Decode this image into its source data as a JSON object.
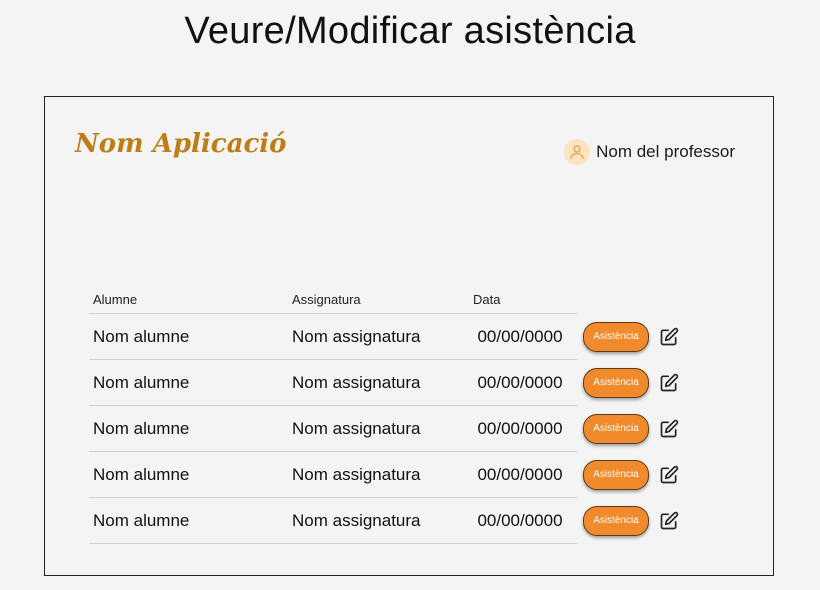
{
  "page_title": "Veure/Modificar asistència",
  "header": {
    "app_name": "Nom Aplicació",
    "user_name": "Nom del professor",
    "avatar_icon": "user-icon"
  },
  "table": {
    "columns": [
      "Alumne",
      "Assignatura",
      "Data"
    ],
    "rows": [
      {
        "alumne": "Nom alumne",
        "assignatura": "Nom assignatura",
        "data": "00/00/0000",
        "button": "Asistència"
      },
      {
        "alumne": "Nom alumne",
        "assignatura": "Nom assignatura",
        "data": "00/00/0000",
        "button": "Asistència"
      },
      {
        "alumne": "Nom alumne",
        "assignatura": "Nom assignatura",
        "data": "00/00/0000",
        "button": "Asistència"
      },
      {
        "alumne": "Nom alumne",
        "assignatura": "Nom assignatura",
        "data": "00/00/0000",
        "button": "Asistència"
      },
      {
        "alumne": "Nom alumne",
        "assignatura": "Nom assignatura",
        "data": "00/00/0000",
        "button": "Asistència"
      }
    ],
    "edit_icon": "edit-icon"
  },
  "colors": {
    "brand": "#bd7e17",
    "button": "#f08a2c",
    "avatar_bg": "#fde3c0"
  }
}
